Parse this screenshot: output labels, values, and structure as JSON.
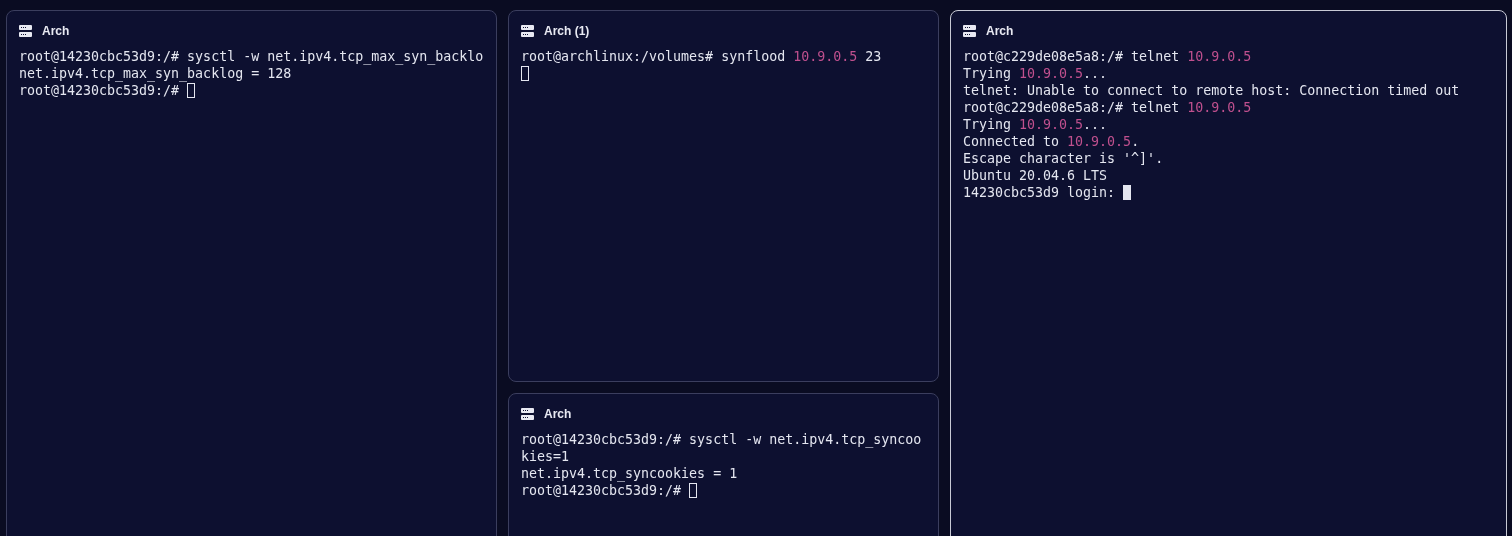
{
  "panes": [
    {
      "title": "Arch",
      "focused": false,
      "lines": [
        [
          {
            "kind": "plain",
            "text": "root@14230cbc53d9:/# sysctl -w net.ipv4.tcp_max_syn_backlo"
          }
        ],
        [
          {
            "kind": "plain",
            "text": "net.ipv4.tcp_max_syn_backlog = 128"
          }
        ],
        [
          {
            "kind": "plain",
            "text": "root@14230cbc53d9:/# "
          },
          {
            "kind": "cursor"
          }
        ]
      ]
    },
    {
      "title": "Arch (1)",
      "focused": false,
      "lines": [
        [
          {
            "kind": "plain",
            "text": "root@archlinux:/volumes# synflood "
          },
          {
            "kind": "ip",
            "text": "10.9.0.5"
          },
          {
            "kind": "plain",
            "text": " 23"
          }
        ],
        [
          {
            "kind": "cursor"
          }
        ]
      ]
    },
    {
      "title": "Arch",
      "focused": false,
      "lines": [
        [
          {
            "kind": "plain",
            "text": "root@14230cbc53d9:/# sysctl -w net.ipv4.tcp_syncoo"
          }
        ],
        [
          {
            "kind": "plain",
            "text": "kies=1"
          }
        ],
        [
          {
            "kind": "plain",
            "text": "net.ipv4.tcp_syncookies = 1"
          }
        ],
        [
          {
            "kind": "plain",
            "text": "root@14230cbc53d9:/# "
          },
          {
            "kind": "cursor"
          }
        ]
      ]
    },
    {
      "title": "Arch",
      "focused": true,
      "lines": [
        [
          {
            "kind": "plain",
            "text": "root@c229de08e5a8:/# telnet "
          },
          {
            "kind": "ip",
            "text": "10.9.0.5"
          }
        ],
        [
          {
            "kind": "plain",
            "text": "Trying "
          },
          {
            "kind": "ip",
            "text": "10.9.0.5"
          },
          {
            "kind": "plain",
            "text": "..."
          }
        ],
        [
          {
            "kind": "plain",
            "text": "telnet: Unable to connect to remote host: Connection timed out"
          }
        ],
        [
          {
            "kind": "plain",
            "text": "root@c229de08e5a8:/# telnet "
          },
          {
            "kind": "ip",
            "text": "10.9.0.5"
          }
        ],
        [
          {
            "kind": "plain",
            "text": "Trying "
          },
          {
            "kind": "ip",
            "text": "10.9.0.5"
          },
          {
            "kind": "plain",
            "text": "..."
          }
        ],
        [
          {
            "kind": "plain",
            "text": "Connected to "
          },
          {
            "kind": "ip",
            "text": "10.9.0.5"
          },
          {
            "kind": "plain",
            "text": "."
          }
        ],
        [
          {
            "kind": "plain",
            "text": "Escape character is '^]'."
          }
        ],
        [
          {
            "kind": "plain",
            "text": "Ubuntu 20.04.6 LTS"
          }
        ],
        [
          {
            "kind": "plain",
            "text": "14230cbc53d9 login: "
          },
          {
            "kind": "cursor"
          }
        ]
      ]
    }
  ]
}
